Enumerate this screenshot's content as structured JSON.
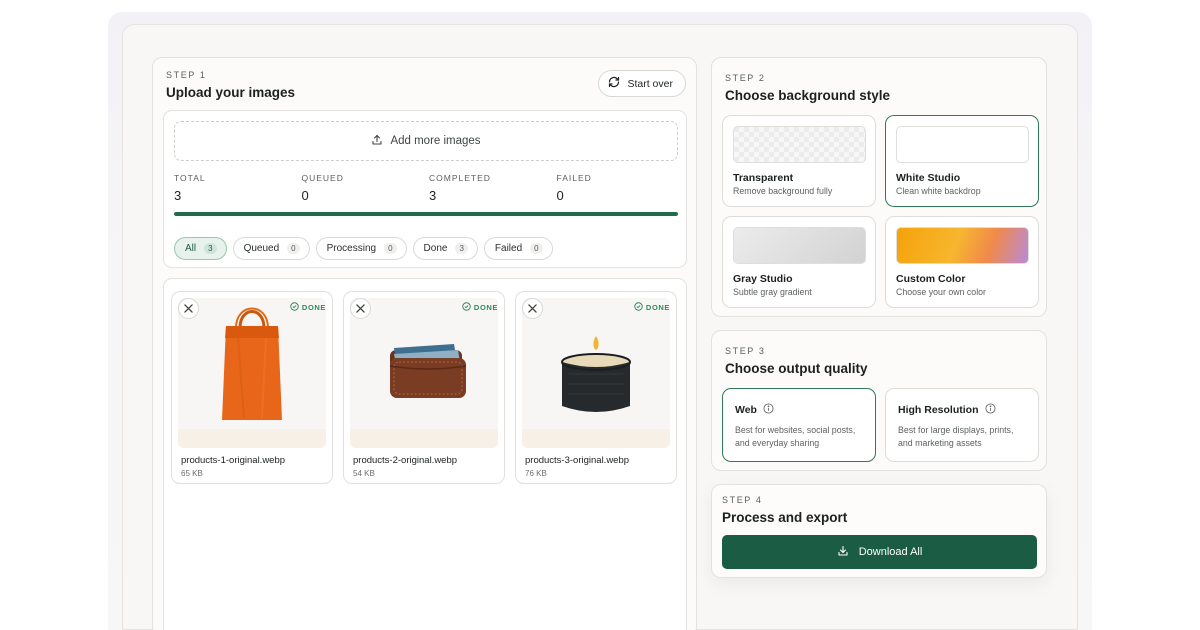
{
  "upload": {
    "step": "STEP 1",
    "title": "Upload your images",
    "start_over_label": "Start over",
    "add_more_label": "Add more images",
    "stats": [
      {
        "label": "TOTAL",
        "value": "3"
      },
      {
        "label": "QUEUED",
        "value": "0"
      },
      {
        "label": "COMPLETED",
        "value": "3"
      },
      {
        "label": "FAILED",
        "value": "0"
      }
    ],
    "progress_fraction": 1.0,
    "filters": [
      {
        "label": "All",
        "count": "3",
        "active": true
      },
      {
        "label": "Queued",
        "count": "0"
      },
      {
        "label": "Processing",
        "count": "0"
      },
      {
        "label": "Done",
        "count": "3"
      },
      {
        "label": "Failed",
        "count": "0"
      }
    ],
    "images": [
      {
        "name": "products-1-original.webp",
        "size": "65 KB",
        "status": "DONE",
        "subject": "orange-tote-bag"
      },
      {
        "name": "products-2-original.webp",
        "size": "54 KB",
        "status": "DONE",
        "subject": "leather-wallet"
      },
      {
        "name": "products-3-original.webp",
        "size": "76 KB",
        "status": "DONE",
        "subject": "black-candle"
      }
    ]
  },
  "background": {
    "step": "STEP 2",
    "title": "Choose background style",
    "options": [
      {
        "title": "Transparent",
        "desc": "Remove background fully"
      },
      {
        "title": "White Studio",
        "desc": "Clean white backdrop",
        "selected": true
      },
      {
        "title": "Gray Studio",
        "desc": "Subtle gray gradient"
      },
      {
        "title": "Custom Color",
        "desc": "Choose your own color"
      }
    ]
  },
  "quality": {
    "step": "STEP 3",
    "title": "Choose output quality",
    "options": [
      {
        "title": "Web",
        "desc": "Best for websites, social posts, and everyday sharing",
        "selected": true
      },
      {
        "title": "High Resolution",
        "desc": "Best for large displays, prints, and marketing assets"
      }
    ]
  },
  "export": {
    "step": "STEP 4",
    "title": "Process and export",
    "download_label": "Download All"
  },
  "colors": {
    "accent": "#1a5c44",
    "selected_border": "#2e7a57",
    "done_badge": "#2e8a5e"
  }
}
